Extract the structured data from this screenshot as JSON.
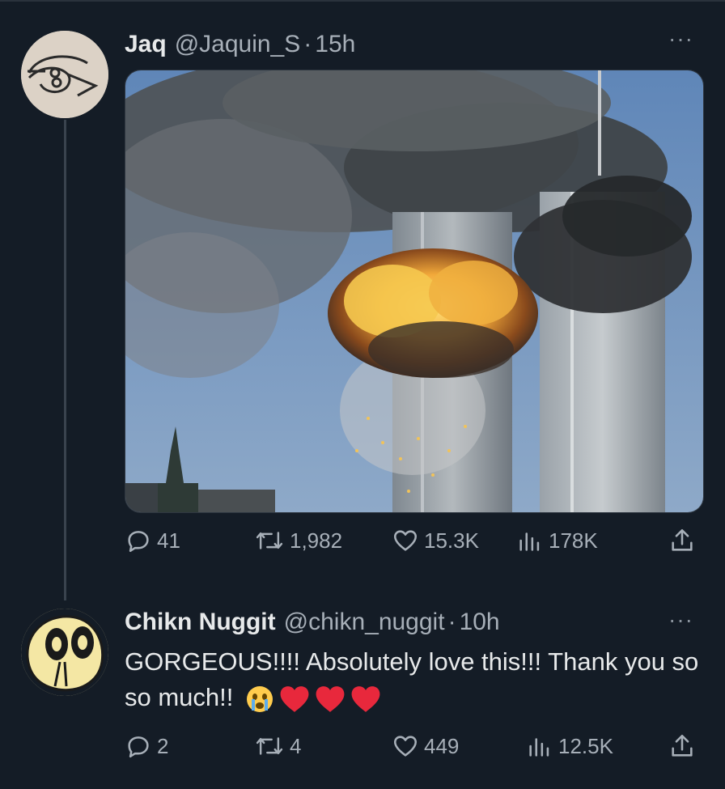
{
  "tweet": {
    "author_name": "Jaq",
    "handle": "@Jaquin_S",
    "separator": "·",
    "time": "15h",
    "more_label": "···",
    "stats": {
      "replies": "41",
      "retweets": "1,982",
      "likes": "15.3K",
      "views": "178K"
    }
  },
  "reply": {
    "author_name": "Chikn Nuggit",
    "handle": "@chikn_nuggit",
    "separator": "·",
    "time": "10h",
    "more_label": "···",
    "text": "GORGEOUS!!!! Absolutely love this!!! Thank you so so much!!",
    "emojis": [
      "crying-face-emoji",
      "red-heart-emoji",
      "red-heart-emoji",
      "red-heart-emoji"
    ],
    "stats": {
      "replies": "2",
      "retweets": "4",
      "likes": "449",
      "views": "12.5K"
    }
  },
  "colors": {
    "background": "#141c26",
    "primary_text": "#e7e9ea",
    "secondary_text": "#a7afb8",
    "heart": "#e8283c"
  }
}
